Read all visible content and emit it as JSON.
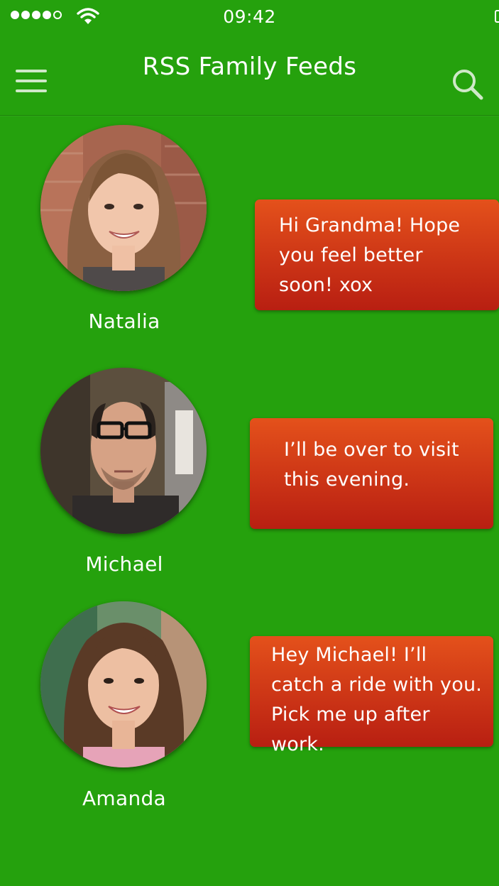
{
  "status_bar": {
    "time": "09:42",
    "signal_icon": "cell-signal-icon",
    "wifi_icon": "wifi-icon",
    "battery_icon": "battery-icon"
  },
  "nav_bar": {
    "title": "RSS Family Feeds",
    "menu_icon": "hamburger-menu-icon",
    "search_icon": "search-icon"
  },
  "colors": {
    "background": "#25a10d",
    "bubble_top": "#e4511b",
    "bubble_bottom": "#b81f12",
    "text": "#ffffff"
  },
  "feed": [
    {
      "name": "Natalia",
      "message_lines": [
        "Hi Grandma!  Hope",
        "you feel better",
        "soon!  xox"
      ]
    },
    {
      "name": "Michael",
      "message_lines": [
        "I’ll be over to visit",
        "this evening."
      ]
    },
    {
      "name": "Amanda",
      "message_lines": [
        "Hey Michael!  I’ll",
        "catch a ride with you.",
        "Pick me up after",
        "work."
      ]
    }
  ]
}
